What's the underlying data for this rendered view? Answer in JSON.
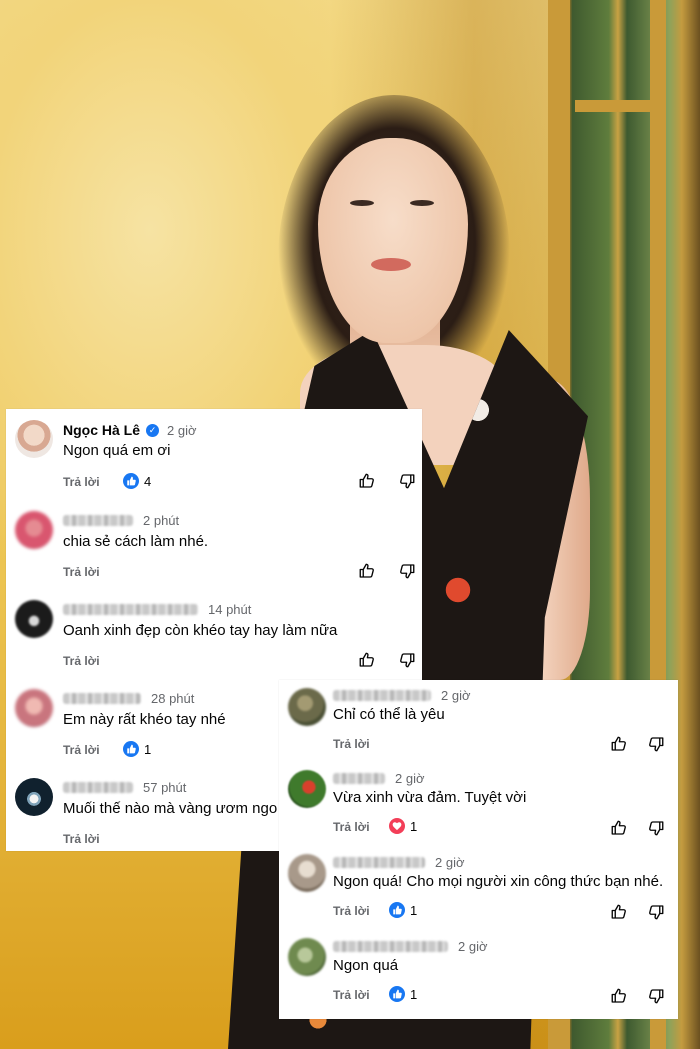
{
  "left_card": {
    "comments": [
      {
        "name": "Ngọc Hà Lê",
        "verified": true,
        "time": "2 giờ",
        "text": "Ngon quá em ơi",
        "reply_label": "Trả lời",
        "like_count": "4",
        "avatar_color": "#e9c8b7"
      },
      {
        "name": "",
        "time": "2 phút",
        "text": "chia sẻ cách làm nhé.",
        "reply_label": "Trả lời",
        "avatar_color": "#d9566f"
      },
      {
        "name": "",
        "time": "14 phút",
        "text": "Oanh xinh đẹp còn khéo tay hay làm nữa",
        "reply_label": "Trả lời",
        "avatar_color": "#1b1b1b"
      },
      {
        "name": "",
        "time": "28 phút",
        "text": "Em này rất khéo tay nhé",
        "reply_label": "Trả lời",
        "like_count": "1",
        "avatar_color": "#c9757e"
      },
      {
        "name": "",
        "time": "57 phút",
        "text": "Muối thế nào mà vàng ươm ngo",
        "reply_label": "Trả lời",
        "avatar_color": "#10212e"
      }
    ]
  },
  "right_card": {
    "comments": [
      {
        "name": "",
        "time": "2 giờ",
        "text": "Chỉ có thể là yêu",
        "reply_label": "Trả lời",
        "avatar_color": "#6b6a4a"
      },
      {
        "name": "",
        "time": "2 giờ",
        "text": "Vừa xinh vừa đảm. Tuyệt vời",
        "reply_label": "Trả lời",
        "love_count": "1",
        "avatar_color": "#3f7a2c"
      },
      {
        "name": "",
        "time": "2 giờ",
        "text": "Ngon quá! Cho mọi người xin công thức bạn nhé.",
        "reply_label": "Trả lời",
        "like_count": "1",
        "avatar_color": "#a8998a"
      },
      {
        "name": "",
        "time": "2 giờ",
        "text": "Ngon quá",
        "reply_label": "Trả lời",
        "like_count": "1",
        "avatar_color": "#6f8a4f"
      }
    ]
  },
  "colors": {
    "like_blue": "#1877f2",
    "love_red": "#f33e58",
    "meta_gray": "#65676b",
    "text_black": "#050505"
  },
  "icons": {
    "like_reaction": "thumbs-up-icon",
    "love_reaction": "heart-icon",
    "upvote": "thumbs-up-outline-icon",
    "downvote": "thumbs-down-outline-icon",
    "verified": "verified-badge-icon"
  }
}
